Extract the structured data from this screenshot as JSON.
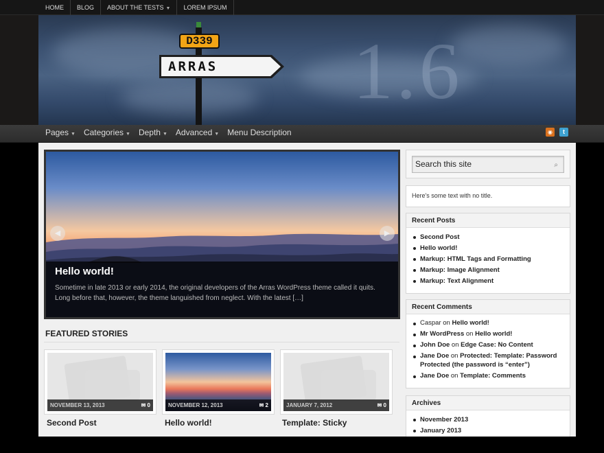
{
  "topnav": {
    "items": [
      {
        "label": "HOME"
      },
      {
        "label": "BLOG"
      },
      {
        "label": "ABOUT THE TESTS",
        "has_dropdown": true
      },
      {
        "label": "LOREM IPSUM"
      }
    ]
  },
  "header": {
    "plate_small": "D339",
    "sign_text": "ARRAS",
    "version": "1.6"
  },
  "mainnav": {
    "items": [
      {
        "label": "Pages",
        "has_dropdown": true
      },
      {
        "label": "Categories",
        "has_dropdown": true
      },
      {
        "label": "Depth",
        "has_dropdown": true
      },
      {
        "label": "Advanced",
        "has_dropdown": true
      },
      {
        "label": "Menu Description",
        "has_dropdown": false
      }
    ],
    "icons": [
      "rss-icon",
      "twitter-icon"
    ]
  },
  "slideshow": {
    "title": "Hello world!",
    "excerpt": "Sometime in late 2013 or early 2014, the original developers of the Arras WordPress theme called it quits. Long before that, however, the theme languished from neglect. With the latest […]",
    "prev_icon": "arrow-left-icon",
    "next_icon": "arrow-right-icon"
  },
  "featured": {
    "heading": "FEATURED STORIES",
    "cards": [
      {
        "title": "Second Post",
        "date": "NOVEMBER 13, 2013",
        "comments": "0",
        "image": "placeholder"
      },
      {
        "title": "Hello world!",
        "date": "NOVEMBER 12, 2013",
        "comments": "2",
        "image": "sunset"
      },
      {
        "title": "Template: Sticky",
        "date": "JANUARY 7, 2012",
        "comments": "0",
        "image": "placeholder"
      }
    ]
  },
  "sidebar": {
    "search_placeholder": "Search this site",
    "notitle_text": "Here's some text with no title.",
    "recent_posts": {
      "heading": "Recent Posts",
      "items": [
        "Second Post",
        "Hello world!",
        "Markup: HTML Tags and Formatting",
        "Markup: Image Alignment",
        "Markup: Text Alignment"
      ]
    },
    "recent_comments": {
      "heading": "Recent Comments",
      "items": [
        {
          "author": "Caspar",
          "on": "on",
          "post": "Hello world!"
        },
        {
          "author": "Mr WordPress",
          "on": "on",
          "post": "Hello world!"
        },
        {
          "author": "John Doe",
          "on": "on",
          "post": "Edge Case: No Content"
        },
        {
          "author": "Jane Doe",
          "on": "on",
          "post": "Protected: Template: Password Protected (the password is “enter”)"
        },
        {
          "author": "Jane Doe",
          "on": "on",
          "post": "Template: Comments"
        }
      ]
    },
    "archives": {
      "heading": "Archives",
      "items": [
        "November 2013",
        "January 2013"
      ]
    }
  },
  "colors": {
    "topbar": "#161616",
    "mainnav": "#333333",
    "content_bg": "#f0f0f0",
    "rss": "#d9711e",
    "twitter": "#3ea1cf"
  }
}
